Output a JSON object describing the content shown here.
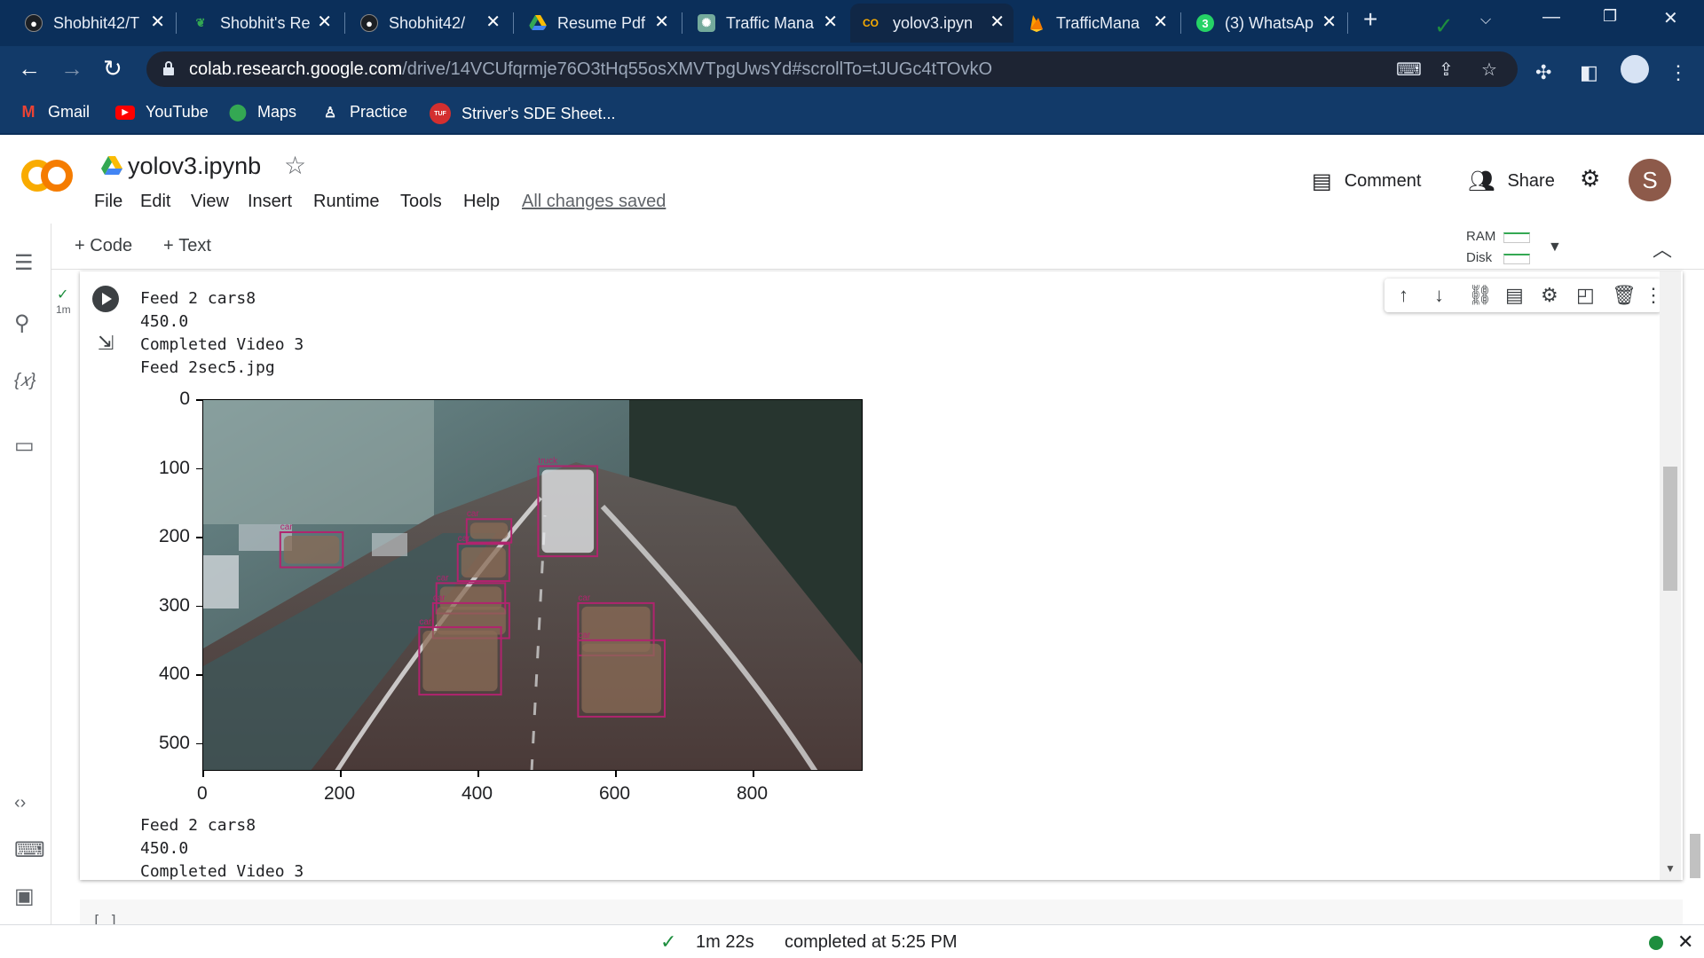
{
  "browser": {
    "tabs": [
      {
        "label": "Shobhit42/T",
        "icon": "github-icon",
        "active": false
      },
      {
        "label": "Shobhit's Re",
        "icon": "leaf-icon",
        "active": false
      },
      {
        "label": "Shobhit42/",
        "icon": "github-icon",
        "active": false
      },
      {
        "label": "Resume Pdf",
        "icon": "google-drive-icon",
        "active": false
      },
      {
        "label": "Traffic Mana",
        "icon": "openai-icon",
        "active": false
      },
      {
        "label": "yolov3.ipyn",
        "icon": "colab-icon",
        "active": true
      },
      {
        "label": "TrafficMana",
        "icon": "firebase-icon",
        "active": false
      },
      {
        "label": "(3) WhatsAp",
        "icon": "whatsapp-icon",
        "active": false
      }
    ],
    "new_tab": "+",
    "url_host": "colab.research.google.com",
    "url_path": "/drive/14VCUfqrmje76O3tHq55osXMVTpgUwsYd#scrollTo=tJUGc4tTOvkO",
    "whatsapp_badge": "3",
    "bookmarks": [
      {
        "label": "Gmail",
        "icon": "gmail-icon"
      },
      {
        "label": "YouTube",
        "icon": "youtube-icon"
      },
      {
        "label": "Maps",
        "icon": "maps-icon"
      },
      {
        "label": "Practice",
        "icon": "gfg-icon"
      },
      {
        "label": "Striver's SDE Sheet...",
        "icon": "tuf-icon"
      }
    ],
    "tuf_text": "TUF"
  },
  "colab": {
    "logo_text": "CO",
    "title": "yolov3.ipynb",
    "menu": [
      "File",
      "Edit",
      "View",
      "Insert",
      "Runtime",
      "Tools",
      "Help"
    ],
    "saved_status": "All changes saved",
    "comment_label": "Comment",
    "share_label": "Share",
    "avatar_initial": "S",
    "toolbar": {
      "code_label": "Code",
      "text_label": "Text",
      "plus": "+"
    },
    "resources": {
      "ram": "RAM",
      "disk": "Disk"
    },
    "cell": {
      "exec_time": "1m",
      "output_before": [
        "Feed 2 cars8",
        "450.0",
        "Completed Video 3",
        "Feed 2sec5.jpg"
      ],
      "output_after": [
        "Feed 2 cars8",
        "450.0",
        "Completed Video 3"
      ]
    },
    "next_cell_prompt": "[ ]",
    "status": {
      "duration": "1m 22s",
      "completed": "completed at 5:25 PM"
    }
  },
  "chart_data": {
    "type": "image",
    "x_ticks": [
      "0",
      "200",
      "400",
      "600",
      "800"
    ],
    "y_ticks": [
      "0",
      "100",
      "200",
      "300",
      "400",
      "500"
    ],
    "xlim": [
      0,
      960
    ],
    "ylim": [
      540,
      0
    ],
    "detections": [
      {
        "label": "car",
        "x1": 112,
        "y1": 192,
        "x2": 203,
        "y2": 243
      },
      {
        "label": "truck",
        "x1": 487,
        "y1": 96,
        "x2": 573,
        "y2": 227
      },
      {
        "label": "car",
        "x1": 383,
        "y1": 173,
        "x2": 448,
        "y2": 207
      },
      {
        "label": "car",
        "x1": 370,
        "y1": 209,
        "x2": 445,
        "y2": 263
      },
      {
        "label": "car",
        "x1": 339,
        "y1": 266,
        "x2": 439,
        "y2": 310
      },
      {
        "label": "car",
        "x1": 334,
        "y1": 295,
        "x2": 445,
        "y2": 346
      },
      {
        "label": "car",
        "x1": 314,
        "y1": 330,
        "x2": 433,
        "y2": 428
      },
      {
        "label": "car",
        "x1": 545,
        "y1": 295,
        "x2": 655,
        "y2": 371
      },
      {
        "label": "car",
        "x1": 545,
        "y1": 349,
        "x2": 671,
        "y2": 460
      }
    ],
    "box_color": "#b0246e"
  }
}
